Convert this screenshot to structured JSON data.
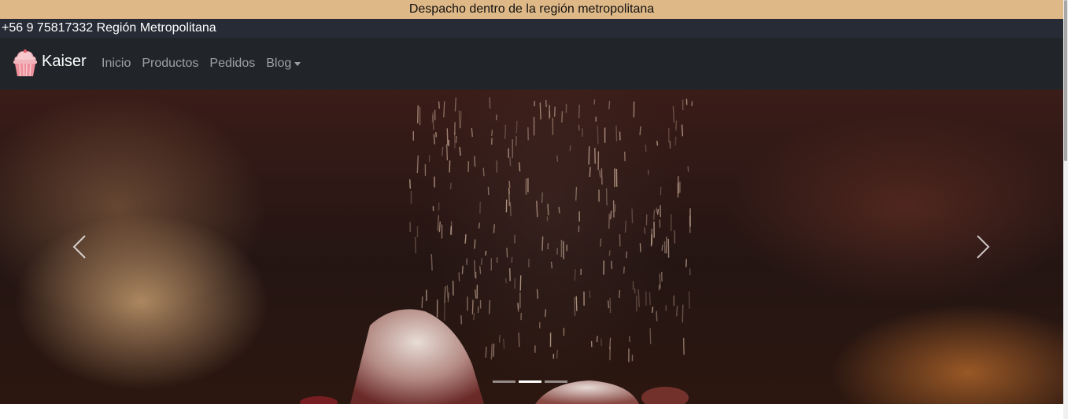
{
  "announcement": {
    "text": "Despacho dentro de la región metropolitana"
  },
  "contact": {
    "text": "+56 9 75817332 Región Metropolitana"
  },
  "navbar": {
    "brand": {
      "name": "Kaiser",
      "icon": "cupcake-icon"
    },
    "links": [
      {
        "label": "Inicio"
      },
      {
        "label": "Productos"
      },
      {
        "label": "Pedidos"
      },
      {
        "label": "Blog",
        "has_dropdown": true
      }
    ]
  },
  "carousel": {
    "prev_icon": "chevron-left-icon",
    "next_icon": "chevron-right-icon",
    "slide_count": 3,
    "active_index": 1
  },
  "colors": {
    "announcement_bg": "#dfb887",
    "contact_bg": "#272b35",
    "navbar_bg": "#212529",
    "nav_link": "rgba(255,255,255,0.56)"
  }
}
